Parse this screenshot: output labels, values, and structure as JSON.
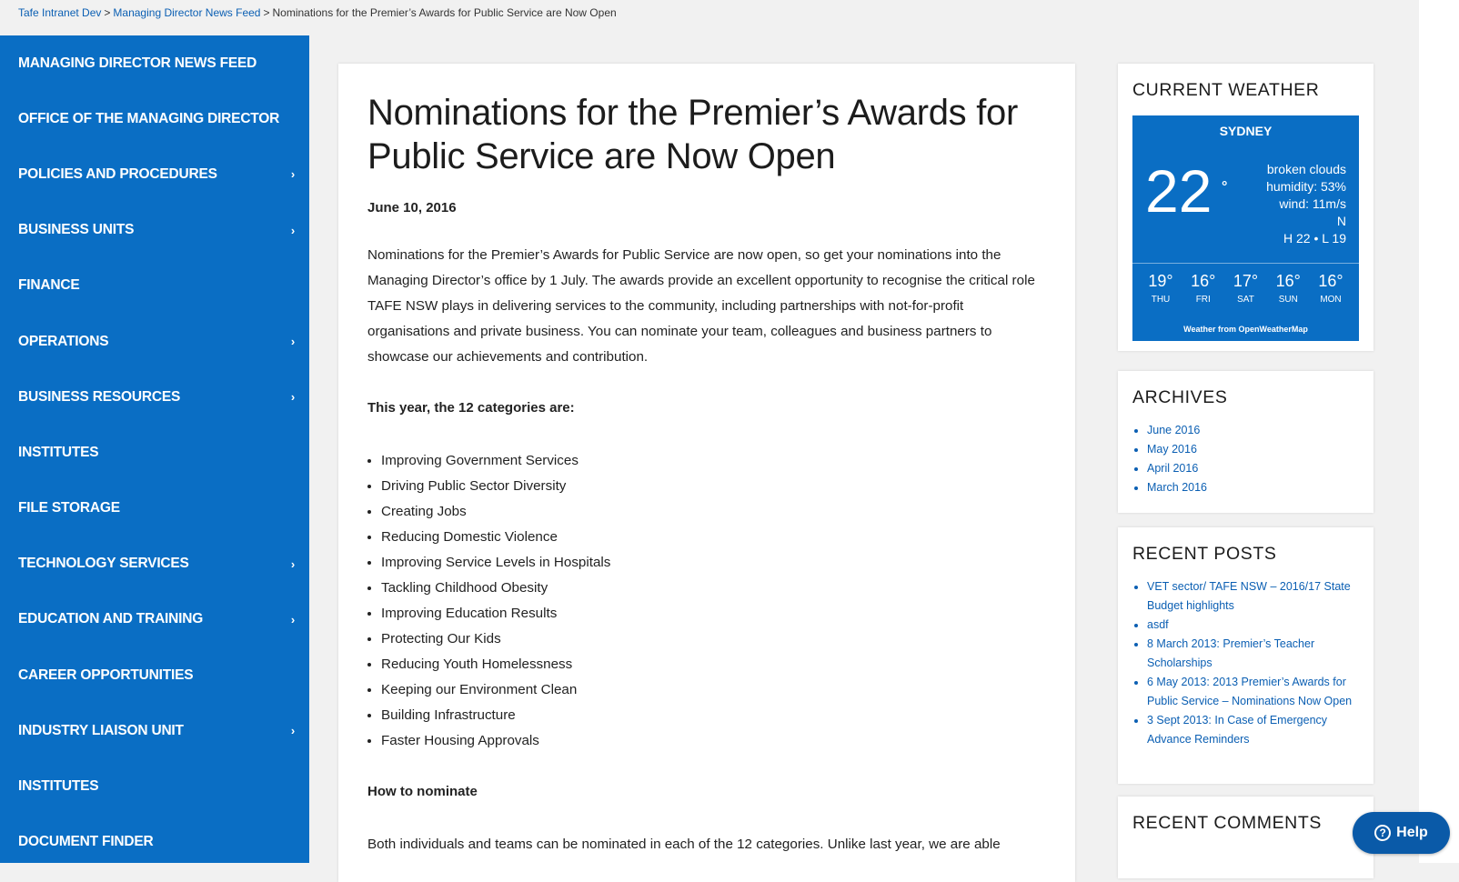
{
  "breadcrumb": {
    "items": [
      "Tafe Intranet Dev",
      "Managing Director News Feed"
    ],
    "current": "Nominations for the Premier’s Awards for Public Service are Now Open",
    "separator": ">"
  },
  "sidebar": {
    "items": [
      {
        "label": "MANAGING DIRECTOR NEWS FEED",
        "chevron": ""
      },
      {
        "label": "OFFICE OF THE MANAGING DIRECTOR",
        "chevron": ""
      },
      {
        "label": "POLICIES AND PROCEDURES",
        "chevron": "›"
      },
      {
        "label": "BUSINESS UNITS",
        "chevron": "›"
      },
      {
        "label": "FINANCE",
        "chevron": ""
      },
      {
        "label": "OPERATIONS",
        "chevron": "›"
      },
      {
        "label": "BUSINESS RESOURCES",
        "chevron": "›"
      },
      {
        "label": "INSTITUTES",
        "chevron": ""
      },
      {
        "label": "FILE STORAGE",
        "chevron": ""
      },
      {
        "label": "TECHNOLOGY SERVICES",
        "chevron": "›"
      },
      {
        "label": "EDUCATION AND TRAINING",
        "chevron": "›"
      },
      {
        "label": "CAREER OPPORTUNITIES",
        "chevron": ""
      },
      {
        "label": "INDUSTRY LIAISON UNIT",
        "chevron": "›"
      },
      {
        "label": "INSTITUTES",
        "chevron": ""
      },
      {
        "label": "DOCUMENT FINDER",
        "chevron": ""
      }
    ]
  },
  "article": {
    "title": "Nominations for the Premier’s Awards for Public Service are Now Open",
    "date": "June 10, 2016",
    "intro": "Nominations for the Premier’s Awards for Public Service are now open, so get your nominations into the Managing Director’s office by 1 July. The awards provide an excellent opportunity to recognise the critical role TAFE NSW plays in delivering services to the community, including partnerships with not-for-profit organisations and private business. You can nominate your team, colleagues and business partners to showcase our achievements and contribution.",
    "categories_heading": "This year, the 12 categories are:",
    "categories": [
      "Improving Government Services",
      "Driving Public Sector Diversity",
      "Creating Jobs",
      "Reducing Domestic Violence",
      "Improving Service Levels in Hospitals",
      "Tackling Childhood Obesity",
      "Improving Education Results",
      "Protecting Our Kids",
      "Reducing Youth Homelessness",
      "Keeping our Environment Clean",
      "Building Infrastructure",
      "Faster Housing Approvals"
    ],
    "how_heading": "How to nominate",
    "how_text": "Both individuals and teams can be nominated in each of the 12 categories. Unlike last year, we are able"
  },
  "weather": {
    "heading": "CURRENT WEATHER",
    "city": "SYDNEY",
    "temp": "22",
    "deg": "°",
    "condition": "broken clouds",
    "humidity": "humidity: 53%",
    "wind": "wind: 11m/s",
    "direction": "N",
    "hilo": "H 22 • L 19",
    "forecast": [
      {
        "temp": "19°",
        "day": "THU"
      },
      {
        "temp": "16°",
        "day": "FRI"
      },
      {
        "temp": "17°",
        "day": "SAT"
      },
      {
        "temp": "16°",
        "day": "SUN"
      },
      {
        "temp": "16°",
        "day": "MON"
      }
    ],
    "credit": "Weather from OpenWeatherMap"
  },
  "archives": {
    "heading": "ARCHIVES",
    "items": [
      "June 2016",
      "May 2016",
      "April 2016",
      "March 2016"
    ]
  },
  "recent_posts": {
    "heading": "RECENT POSTS",
    "items": [
      "VET sector/ TAFE NSW – 2016/17 State Budget highlights",
      "asdf",
      "8 March 2013: Premier’s Teacher Scholarships",
      "6 May 2013: 2013 Premier’s Awards for Public Service – Nominations Now Open",
      "3 Sept 2013: In Case of Emergency Advance Reminders"
    ]
  },
  "recent_comments": {
    "heading": "RECENT COMMENTS"
  },
  "help": {
    "label": "Help",
    "icon": "?"
  },
  "colors": {
    "brand_blue": "#0a6ec4",
    "link_blue": "#0b5fb3",
    "help_blue": "#0a5aa8"
  }
}
